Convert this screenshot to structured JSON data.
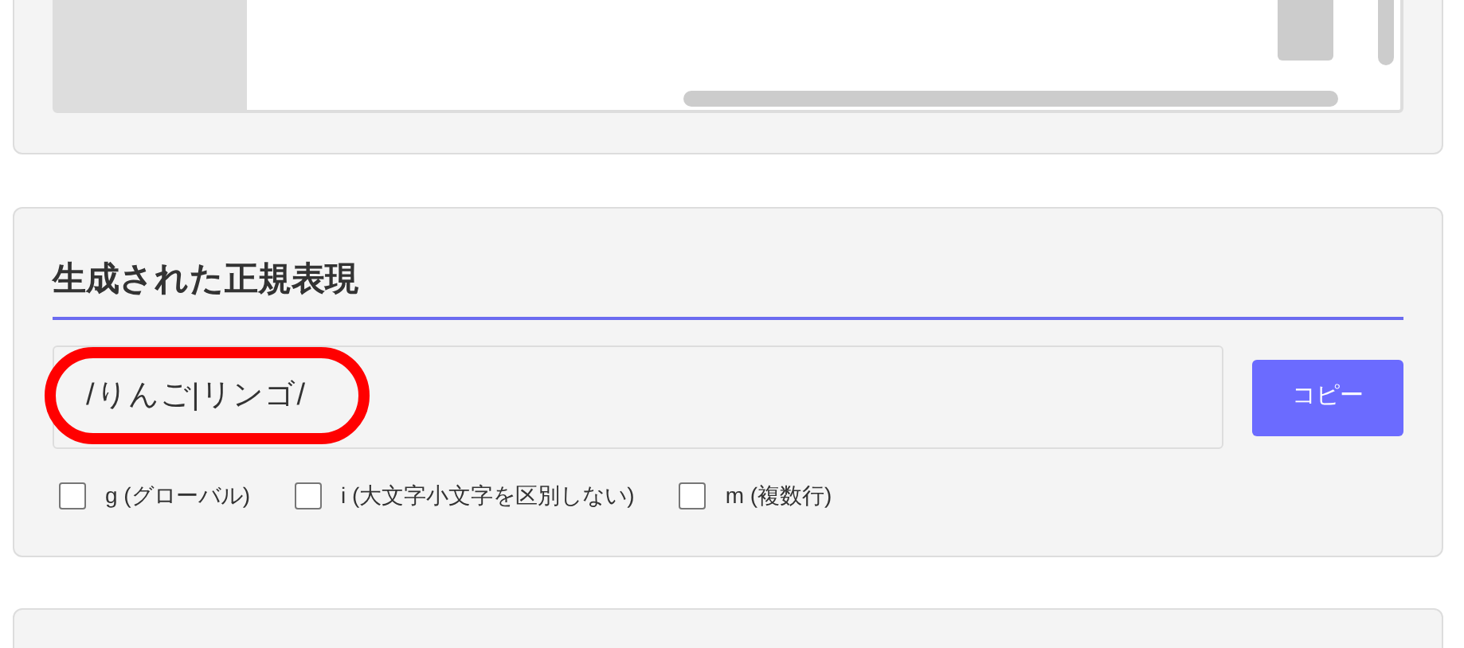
{
  "section": {
    "title": "生成された正規表現",
    "output": {
      "value": "/りんご|リンゴ/",
      "highlighted": true
    },
    "copy_button": "コピー",
    "flags": [
      {
        "label": "g (グローバル)",
        "checked": false
      },
      {
        "label": "i (大文字小文字を区別しない)",
        "checked": false
      },
      {
        "label": "m (複数行)",
        "checked": false
      }
    ]
  }
}
